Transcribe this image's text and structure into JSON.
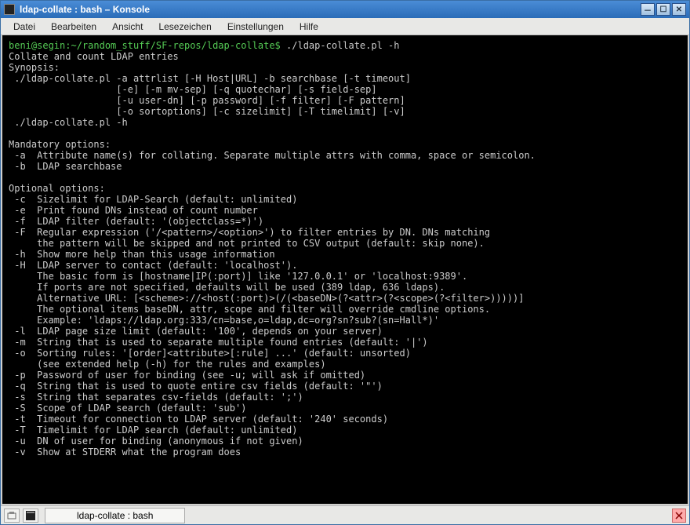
{
  "window": {
    "title": "ldap-collate : bash – Konsole"
  },
  "menu": {
    "items": [
      "Datei",
      "Bearbeiten",
      "Ansicht",
      "Lesezeichen",
      "Einstellungen",
      "Hilfe"
    ]
  },
  "terminal": {
    "prompt": "beni@segin:~/random_stuff/SF-repos/ldap-collate$ ",
    "command": "./ldap-collate.pl -h",
    "output": "Collate and count LDAP entries\nSynopsis:\n ./ldap-collate.pl -a attrlist [-H Host|URL] -b searchbase [-t timeout]\n                   [-e] [-m mv-sep] [-q quotechar] [-s field-sep]\n                   [-u user-dn] [-p password] [-f filter] [-F pattern]\n                   [-o sortoptions] [-c sizelimit] [-T timelimit] [-v]\n ./ldap-collate.pl -h\n\nMandatory options:\n -a  Attribute name(s) for collating. Separate multiple attrs with comma, space or semicolon.\n -b  LDAP searchbase\n\nOptional options:\n -c  Sizelimit for LDAP-Search (default: unlimited)\n -e  Print found DNs instead of count number\n -f  LDAP filter (default: '(objectclass=*)')\n -F  Regular expression ('/<pattern>/<option>') to filter entries by DN. DNs matching\n     the pattern will be skipped and not printed to CSV output (default: skip none).\n -h  Show more help than this usage information\n -H  LDAP server to contact (default: 'localhost').\n     The basic form is [hostname|IP(:port)] like '127.0.0.1' or 'localhost:9389'.\n     If ports are not specified, defaults will be used (389 ldap, 636 ldaps).\n     Alternative URL: [<scheme>://<host(:port)>(/(<baseDN>(?<attr>(?<scope>(?<filter>)))))]\n     The optional items baseDN, attr, scope and filter will override cmdline options.\n     Example: 'ldaps://ldap.org:333/cn=base,o=ldap,dc=org?sn?sub?(sn=Hall*)'\n -l  LDAP page size limit (default: '100', depends on your server)\n -m  String that is used to separate multiple found entries (default: '|')\n -o  Sorting rules: '[order]<attribute>[:rule] ...' (default: unsorted)\n     (see extended help (-h) for the rules and examples)\n -p  Password of user for binding (see -u; will ask if omitted)\n -q  String that is used to quote entire csv fields (default: '\"')\n -s  String that separates csv-fields (default: ';')\n -S  Scope of LDAP search (default: 'sub')\n -t  Timeout for connection to LDAP server (default: '240' seconds)\n -T  Timelimit for LDAP search (default: unlimited)\n -u  DN of user for binding (anonymous if not given)\n -v  Show at STDERR what the program does\n"
  },
  "statusbar": {
    "tab_label": "ldap-collate : bash"
  }
}
